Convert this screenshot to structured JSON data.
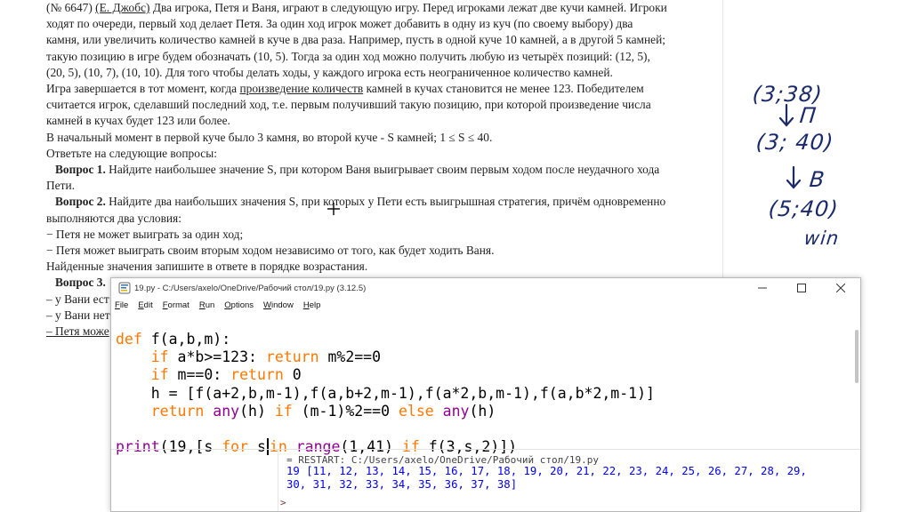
{
  "document": {
    "lines": [
      "(№ 6647) (Е. Джобс) Два игрока, Петя и Ваня, играют в следующую игру. Перед игроками лежат две кучи камней. Игроки",
      "ходят по очереди, первый ход делает Петя. За один ход игрок может добавить в одну из куч (по своему выбору) два",
      "камня, или увеличить количество камней в куче в два раза. Например, пусть в одной куче 10 камней, а в другой 5 камней;",
      "такую позицию в игре будем обозначать (10, 5). Тогда за один ход можно получить любую из четырёх позиций: (12, 5),",
      "(20, 5), (10, 7), (10, 10). Для того чтобы делать ходы, у каждого игрока есть неограниченное количество камней.",
      "Игра завершается в тот момент, когда произведение количеств камней в кучах становится не менее 123. Победителем",
      "считается игрок, сделавший последний ход, т.е. первым получивший такую позицию, при которой произведение числа",
      "камней в кучах будет 123 или более.",
      "В начальный момент в первой куче было 3 камня, во второй куче - S камней; 1 ≤ S ≤ 40.",
      "Ответьте на следующие вопросы:"
    ],
    "q1_label": "Вопрос 1.",
    "q1_text": " Найдите наибольшее значение S, при котором Ваня выигрывает своим первым ходом после неудачного хода",
    "q1_text2": "Пети.",
    "q2_label": "Вопрос 2.",
    "q2_text": " Найдите два наибольших значения S, при которых у Пети есть выигрышная стратегия, причём одновременно",
    "q2_text2": "выполняются два условия:",
    "q2_cond1": "− Петя не может выиграть за один ход;",
    "q2_cond2": "− Петя может выиграть своим вторым ходом независимо от того, как будет ходить Ваня.",
    "q2_note": "Найденные значения запишите в ответе в порядке возрастания.",
    "q3_label": "Вопрос 3.",
    "q3_cut1": "– у Вани ест",
    "q3_cut2": "– у Вани нет",
    "q3_cut3": "– Петя може"
  },
  "handwriting": {
    "pos1": "(3;38)",
    "mover1": "П",
    "pos2": "(3; 40)",
    "mover2": "В",
    "pos3": "(5;40)",
    "result": "win"
  },
  "idle_window": {
    "title": "19.py - C:/Users/axelo/OneDrive/Рабочий стол/19.py (3.12.5)",
    "menu": [
      "File",
      "Edit",
      "Format",
      "Run",
      "Options",
      "Window",
      "Help"
    ],
    "code": {
      "l1_kw": "def",
      "l1_rest": " f(a,b,m):",
      "l2_kw": "if",
      "l2_rest": " a*b>=123: ",
      "l2_kw2": "return",
      "l2_rest2": " m%2==0",
      "l3_kw": "if",
      "l3_rest": " m==0: ",
      "l3_kw2": "return",
      "l3_rest2": " 0",
      "l4": "h = [f(a+2,b,m-1),f(a,b+2,m-1),f(a*2,b,m-1),f(a,b*2,m-1)]",
      "l5_kw": "return",
      "l5_bi": "any",
      "l5_mid": "(h) ",
      "l5_kw2": "if",
      "l5_mid2": " (m-1)%2==0 ",
      "l5_kw3": "else",
      "l5_bi2": "any",
      "l5_end": "(h)",
      "l6_bi": "print",
      "l6_a": "(19,[s ",
      "l6_kw": "for",
      "l6_b": " s",
      "l6_kw2": "in",
      "l6_bi2": "range",
      "l6_c": "(1,41) ",
      "l6_kw3": "if",
      "l6_d": " f(3,s,2)])"
    },
    "shell": {
      "restart": "= RESTART: C:/Users/axelo/OneDrive/Рабочий стол/19.py",
      "output_l1": "19 [11, 12, 13, 14, 15, 16, 17, 18, 19, 20, 21, 22, 23, 24, 25, 26, 27, 28, 29,",
      "output_l2": "30, 31, 32, 33, 34, 35, 36, 37, 38]",
      "prompt": ">"
    }
  },
  "colors": {
    "keyword": "#ff7700",
    "builtin": "#900090",
    "shell_output": "#0000ee",
    "handwriting": "#1b2a6b"
  }
}
